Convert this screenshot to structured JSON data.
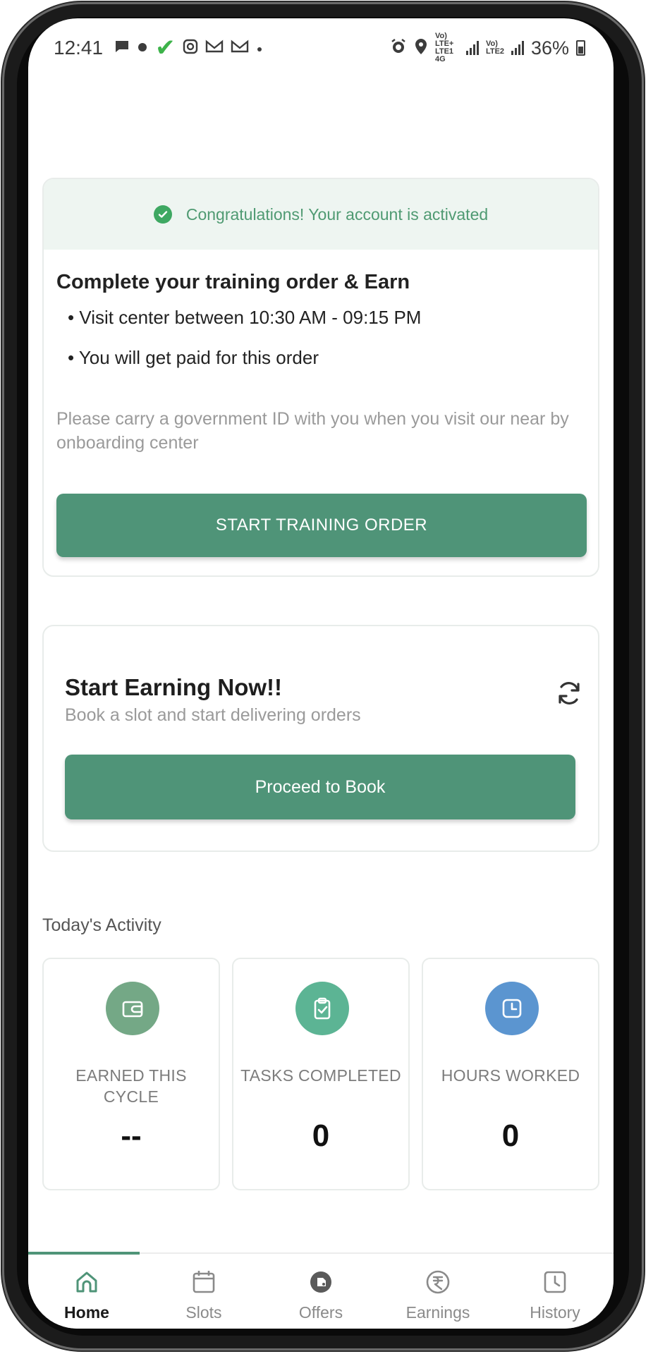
{
  "status_bar": {
    "time": "12:41",
    "battery": "36%",
    "net_label_1": "Vo) LTE+ LTE1 4G",
    "net_label_2": "Vo) LTE2",
    "icons": [
      "message-icon",
      "dot-icon",
      "check-icon",
      "instagram-icon",
      "mail-icon",
      "mail-icon",
      "more-dot-icon",
      "alarm-icon",
      "location-icon",
      "signal-icon",
      "signal-icon",
      "battery-icon"
    ]
  },
  "training_card": {
    "banner_text": "Congratulations! Your account is activated",
    "title": "Complete your training order & Earn",
    "bullets": [
      "• Visit center between 10:30 AM - 09:15 PM",
      "• You will get paid for this order"
    ],
    "note": "Please carry a government ID with you when you visit our near by onboarding center",
    "button_label": "START TRAINING ORDER"
  },
  "earning_card": {
    "title": "Start Earning Now!!",
    "subtitle": "Book a slot and start delivering orders",
    "button_label": "Proceed to Book"
  },
  "activity": {
    "heading": "Today's Activity",
    "stats": [
      {
        "label": "EARNED THIS CYCLE",
        "value": "--",
        "icon": "wallet-icon",
        "color": "#74a886"
      },
      {
        "label": "TASKS COMPLETED",
        "value": "0",
        "icon": "clipboard-check-icon",
        "color": "#5cb494"
      },
      {
        "label": "HOURS WORKED",
        "value": "0",
        "icon": "clock-icon",
        "color": "#5b95d0"
      }
    ]
  },
  "bottom_nav": {
    "items": [
      {
        "label": "Home",
        "icon": "home-icon",
        "active": true
      },
      {
        "label": "Slots",
        "icon": "calendar-icon",
        "active": false
      },
      {
        "label": "Offers",
        "icon": "offers-icon",
        "active": false
      },
      {
        "label": "Earnings",
        "icon": "rupee-icon",
        "active": false
      },
      {
        "label": "History",
        "icon": "history-icon",
        "active": false
      }
    ]
  },
  "colors": {
    "accent": "#4f9478",
    "banner_bg": "#eef5f1",
    "banner_text": "#4f9a72"
  }
}
